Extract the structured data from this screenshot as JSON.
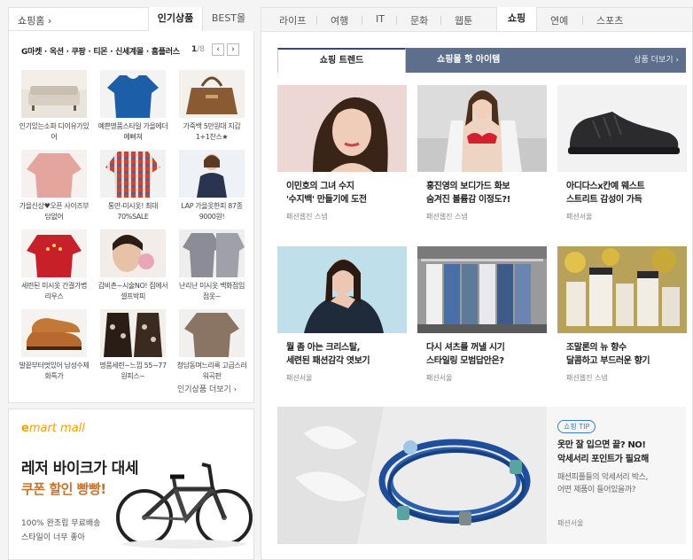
{
  "left": {
    "home_label": "쇼핑홈 ›",
    "tabs": [
      {
        "label": "인기상품",
        "active": true
      },
      {
        "label": "BEST몰",
        "active": false
      }
    ],
    "categories_line": "G마켓 · 옥션 · 쿠팡 · 티몬 · 신세계몰 · 홈플러스",
    "pager": {
      "current": "1",
      "total": "/8"
    },
    "pager_prev": "‹",
    "pager_next": "›",
    "items": [
      {
        "caption": "인기있는소파 디이유가있어",
        "icon": "sofa"
      },
      {
        "caption": "예쁜명품스타일 가을에더예뻐져",
        "icon": "blue-top"
      },
      {
        "caption": "가죽백 5만원대 지갑1+1찬스★",
        "icon": "leather-bag"
      },
      {
        "caption": "가을신상♥오픈 사이즈부담없어",
        "icon": "pink-blouse"
      },
      {
        "caption": "통만-미시옷! 최대70%SALE",
        "icon": "plaid-shirt"
      },
      {
        "caption": "LAP 가을옷한피 87종 9000원!",
        "icon": "model-black"
      },
      {
        "caption": "세련된 미시옷 간결가볍리우스",
        "icon": "red-top"
      },
      {
        "caption": "갑비촌~시술NO! 집에서셀프박피",
        "icon": "face-mask"
      },
      {
        "caption": "난리난 미시옷 백화점입점옷~",
        "icon": "grey-shirt"
      },
      {
        "caption": "발끝부터멋있어 남성수제화특가",
        "icon": "brown-shoes"
      },
      {
        "caption": "명품세련~느낌 55~77 원피스~",
        "icon": "lace-dress"
      },
      {
        "caption": "청담동며느리룩 고급스러워곡판",
        "icon": "knit-top"
      }
    ],
    "more_link": "인기상품 더보기 ›",
    "emart": {
      "logo_main": "e",
      "logo_rest": "mart mall",
      "title": "레저 바이크가 대세",
      "subtitle": "쿠폰 할인 빵빵!",
      "note1": "100% 완조립 무료배송",
      "note2": "스타일이 너무 좋아"
    }
  },
  "right": {
    "nav": [
      {
        "label": "라이프"
      },
      {
        "label": "여행"
      },
      {
        "label": "IT"
      },
      {
        "label": "문화"
      },
      {
        "label": "웹툰"
      },
      {
        "label": "쇼핑",
        "active": true
      },
      {
        "label": "연예"
      },
      {
        "label": "스포츠"
      }
    ],
    "tab_active": "쇼핑 트렌드",
    "tab_inactive": "쇼핑몰 핫 아이템",
    "more_link": "상품 더보기 ›",
    "cards": [
      {
        "title1": "이민호의 그녀 수지",
        "title2": "'수지백' 만들기에 도전",
        "source": "패션웹진 스냅",
        "image": "woman-portrait"
      },
      {
        "title1": "홍진영의 보디가드 화보",
        "title2": "숨겨진 볼륨감 이정도?!",
        "source": "패션웹진 스냅",
        "image": "woman-red-bra"
      },
      {
        "title1": "아디다스x칸예 웨스트",
        "title2": "스트리트 감성이 가득",
        "source": "패션서울",
        "image": "black-sneaker"
      },
      {
        "title1": "뭘 좀 아는 크리스탈,",
        "title2": "세련된 패션감각 엿보기",
        "source": "패션서울",
        "image": "woman-knit"
      },
      {
        "title1": "다시 셔츠를 꺼낼 시기",
        "title2": "스타일링 모범답안은?",
        "source": "패션서울",
        "image": "shirt-rack"
      },
      {
        "title1": "조말론의 뉴 향수",
        "title2": "달콤하고 부드러운 향기",
        "source": "패션웹진 스냅",
        "image": "perfume-bottles"
      }
    ],
    "tip": {
      "badge": "쇼핑 TIP",
      "title1": "옷만 잘 입으면 끝? NO!",
      "title2": "악세서리 포인트가 필요해",
      "desc1": "패션피플들의 악세서리 박스,",
      "desc2": "어떤 제품이 들어있을까?",
      "source": "패션서울",
      "image": "blue-bracelet"
    }
  }
}
